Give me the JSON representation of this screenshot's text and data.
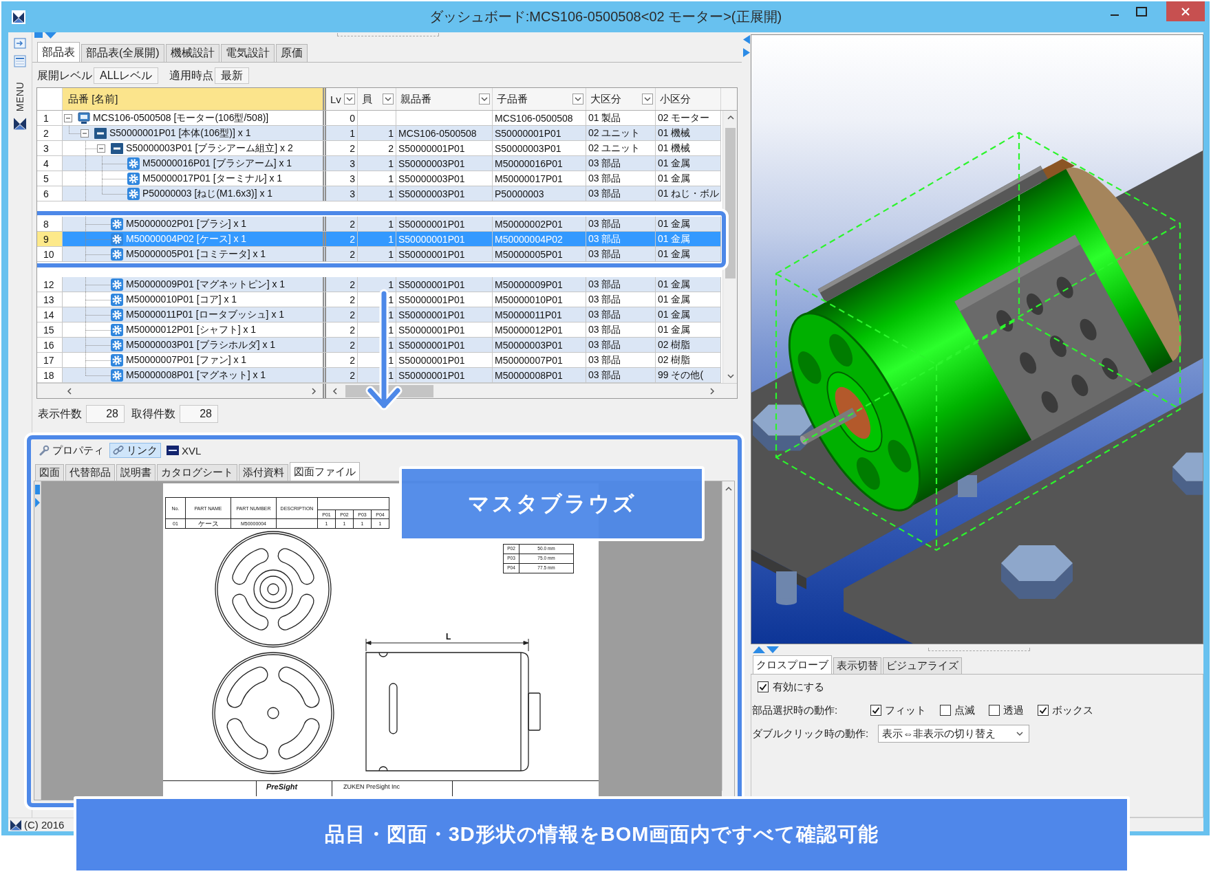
{
  "window": {
    "title": "ダッシュボード:MCS106-0500508<02 モーター>(正展開)"
  },
  "menu_sidebar": {
    "label": "MENU"
  },
  "tabs": [
    {
      "label": "部品表",
      "selected": true
    },
    {
      "label": "部品表(全展開)",
      "selected": false
    },
    {
      "label": "機械設計",
      "selected": false
    },
    {
      "label": "電気設計",
      "selected": false
    },
    {
      "label": "原価",
      "selected": false
    }
  ],
  "toolbar": [
    {
      "label": "展開レベル",
      "value": "ALLレベル"
    },
    {
      "label": "適用時点",
      "value": "最新"
    }
  ],
  "table": {
    "columns": [
      {
        "label": "品番 [名前]",
        "filter": false
      },
      {
        "label": "Lv",
        "filter": true
      },
      {
        "label": "員",
        "filter": true
      },
      {
        "label": "親品番",
        "filter": true
      },
      {
        "label": "子品番",
        "filter": true
      },
      {
        "label": "大区分",
        "filter": true
      },
      {
        "label": "小区分",
        "filter": false
      }
    ],
    "rows": [
      {
        "number": "1",
        "name": "MCS106-0500508 [モーター(106型/508)]",
        "kind": "product",
        "expanded": true,
        "selected": false,
        "highlighted": false,
        "lv": "0",
        "child": "MCS106-0500508",
        "major": "01 製品",
        "minor": "02 モーター",
        "children": [
          {
            "number": "2",
            "name": "S50000001P01 [本体(106型)] x 1",
            "kind": "assembly",
            "expanded": true,
            "selected": false,
            "highlighted": false,
            "lv": "1",
            "qty": "1",
            "parent": "MCS106-0500508",
            "child": "S50000001P01",
            "major": "02 ユニット",
            "minor": "01 機械",
            "children": [
              {
                "number": "3",
                "name": "S50000003P01 [ブラシアーム組立] x 2",
                "kind": "assembly",
                "expanded": true,
                "selected": false,
                "highlighted": false,
                "lv": "2",
                "qty": "2",
                "parent": "S50000001P01",
                "child": "S50000003P01",
                "major": "02 ユニット",
                "minor": "01 機械",
                "children": [
                  {
                    "number": "4",
                    "name": "M50000016P01 [ブラシアーム] x 1",
                    "kind": "part",
                    "selected": false,
                    "highlighted": false,
                    "lv": "3",
                    "qty": "1",
                    "parent": "S50000003P01",
                    "child": "M50000016P01",
                    "major": "03 部品",
                    "minor": "01 金属"
                  },
                  {
                    "number": "5",
                    "name": "M50000017P01 [ターミナル] x 1",
                    "kind": "part",
                    "selected": false,
                    "highlighted": false,
                    "lv": "3",
                    "qty": "1",
                    "parent": "S50000003P01",
                    "child": "M50000017P01",
                    "major": "03 部品",
                    "minor": "01 金属"
                  },
                  {
                    "number": "6",
                    "name": "P50000003 [ねじ(M1.6x3)] x 1",
                    "kind": "part",
                    "selected": false,
                    "highlighted": false,
                    "lv": "3",
                    "qty": "1",
                    "parent": "S50000003P01",
                    "child": "P50000003",
                    "major": "03 部品",
                    "minor": "01 ねじ・ボル"
                  }
                ]
              },
              {
                "number": "8",
                "name": "M50000002P01 [ブラシ] x 1",
                "kind": "part",
                "selected": false,
                "highlighted": true,
                "lv": "2",
                "qty": "1",
                "parent": "S50000001P01",
                "child": "M50000002P01",
                "major": "03 部品",
                "minor": "01 金属"
              },
              {
                "number": "9",
                "name": "M50000004P02 [ケース] x 1",
                "kind": "part",
                "selected": true,
                "highlighted": true,
                "lv": "2",
                "qty": "1",
                "parent": "S50000001P01",
                "child": "M50000004P02",
                "major": "03 部品",
                "minor": "01 金属"
              },
              {
                "number": "10",
                "name": "M50000005P01 [コミテータ] x 1",
                "kind": "part",
                "selected": false,
                "highlighted": true,
                "lv": "2",
                "qty": "1",
                "parent": "S50000001P01",
                "child": "M50000005P01",
                "major": "03 部品",
                "minor": "01 金属"
              },
              {
                "number": "12",
                "name": "M50000009P01 [マグネットピン] x 1",
                "kind": "part",
                "selected": false,
                "highlighted": false,
                "lv": "2",
                "qty": "1",
                "parent": "S50000001P01",
                "child": "M50000009P01",
                "major": "03 部品",
                "minor": "01 金属"
              },
              {
                "number": "13",
                "name": "M50000010P01 [コア] x 1",
                "kind": "part",
                "selected": false,
                "highlighted": false,
                "lv": "2",
                "qty": "1",
                "parent": "S50000001P01",
                "child": "M50000010P01",
                "major": "03 部品",
                "minor": "01 金属"
              },
              {
                "number": "14",
                "name": "M50000011P01 [ロータブッシュ] x 1",
                "kind": "part",
                "selected": false,
                "highlighted": false,
                "lv": "2",
                "qty": "1",
                "parent": "S50000001P01",
                "child": "M50000011P01",
                "major": "03 部品",
                "minor": "01 金属"
              },
              {
                "number": "15",
                "name": "M50000012P01 [シャフト] x 1",
                "kind": "part",
                "selected": false,
                "highlighted": false,
                "lv": "2",
                "qty": "1",
                "parent": "S50000001P01",
                "child": "M50000012P01",
                "major": "03 部品",
                "minor": "01 金属"
              },
              {
                "number": "16",
                "name": "M50000003P01 [ブラシホルダ] x 1",
                "kind": "part",
                "selected": false,
                "highlighted": false,
                "lv": "2",
                "qty": "1",
                "parent": "S50000001P01",
                "child": "M50000003P01",
                "major": "03 部品",
                "minor": "02 樹脂"
              },
              {
                "number": "17",
                "name": "M50000007P01 [ファン] x 1",
                "kind": "part",
                "selected": false,
                "highlighted": false,
                "lv": "2",
                "qty": "1",
                "parent": "S50000001P01",
                "child": "M50000007P01",
                "major": "03 部品",
                "minor": "02 樹脂"
              },
              {
                "number": "18",
                "name": "M50000008P01 [マグネット] x 1",
                "kind": "part",
                "selected": false,
                "highlighted": false,
                "lv": "2",
                "qty": "1",
                "parent": "S50000001P01",
                "child": "M50000008P01",
                "major": "03 部品",
                "minor": "99 その他("
              }
            ]
          }
        ]
      }
    ]
  },
  "counts": [
    {
      "label": "表示件数",
      "value": "28"
    },
    {
      "label": "取得件数",
      "value": "28"
    }
  ],
  "detail_panel": {
    "highlighted": true,
    "tabs": [
      {
        "label": "プロパティ",
        "kind": "wrench",
        "selected": false
      },
      {
        "label": "リンク",
        "kind": "link",
        "selected": true
      },
      {
        "label": "XVL",
        "kind": "tile",
        "selected": false
      }
    ],
    "subtabs": [
      {
        "label": "図面",
        "selected": false
      },
      {
        "label": "代替部品",
        "selected": false
      },
      {
        "label": "説明書",
        "selected": false
      },
      {
        "label": "カタログシート",
        "selected": false
      },
      {
        "label": "添付資料",
        "selected": false
      },
      {
        "label": "図面ファイル",
        "selected": true
      }
    ],
    "drawing_sheet": {
      "table_headers": [
        "No.",
        "PART NAME",
        "PART NUMBER",
        "DESCRIPTION"
      ],
      "variant_headers": [
        "P01",
        "P02",
        "P03",
        "P04"
      ],
      "table_row": {
        "no": "01",
        "name": "ケース",
        "number": "M50000004",
        "values": [
          "1",
          "1",
          "1",
          "1"
        ]
      },
      "spec_rows": [
        {
          "variant": "P02",
          "length": "50.0 mm"
        },
        {
          "variant": "P03",
          "length": "75.0 mm"
        },
        {
          "variant": "P04",
          "length": "77.5 mm"
        }
      ],
      "dimension": "L",
      "title_block": {
        "logo": "PreSight",
        "company": "ZUKEN PreSight Inc"
      }
    },
    "callout": "マスタブラウズ"
  },
  "cross_probe": {
    "tabs": [
      {
        "label": "クロスプローブ",
        "selected": true
      },
      {
        "label": "表示切替",
        "selected": false
      },
      {
        "label": "ビジュアライズ",
        "selected": false
      }
    ],
    "enable": {
      "label": "有効にする",
      "checked": true
    },
    "selection": {
      "label": "部品選択時の動作:",
      "options": [
        {
          "label": "フィット",
          "checked": true
        },
        {
          "label": "点滅",
          "checked": false
        },
        {
          "label": "透過",
          "checked": false
        },
        {
          "label": "ボックス",
          "checked": true
        }
      ]
    },
    "double_click": {
      "label": "ダブルクリック時の動作:",
      "value": "表示⇔非表示の切り替え"
    }
  },
  "status_bar": {
    "copyright": "(C) 2016"
  },
  "caption": "品目・図面・3D形状の情報をBOM画面内ですべて確認可能"
}
